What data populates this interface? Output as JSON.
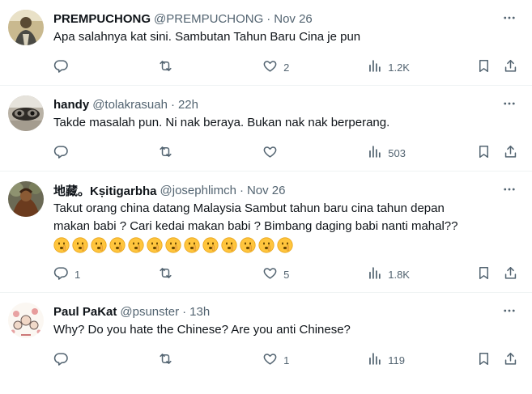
{
  "tweets": [
    {
      "name": "PREMPUCHONG",
      "handle": "@PREMPUCHONG",
      "dot": "·",
      "time": "Nov 26",
      "lines": [
        "Apa salahnya kat sini. Sambutan Tahun Baru Cina je pun"
      ],
      "emoji_count": 0,
      "replies": "",
      "retweets": "",
      "likes": "2",
      "views": "1.2K"
    },
    {
      "name": "handy",
      "handle": "@tolakrasuah",
      "dot": "·",
      "time": "22h",
      "lines": [
        "Takde masalah pun. Ni nak beraya. Bukan nak nak berperang."
      ],
      "emoji_count": 0,
      "replies": "",
      "retweets": "",
      "likes": "",
      "views": "503"
    },
    {
      "name": "地藏。Kṣitigarbha",
      "handle": "@josephlimch",
      "dot": "·",
      "time": "Nov 26",
      "lines": [
        "Takut orang china datang Malaysia Sambut tahun baru cina tahun depan",
        "makan babi ? Cari kedai makan babi ? Bimbang daging babi nanti mahal??"
      ],
      "emoji_count": 13,
      "emoji_name": "shushing-face-emoji",
      "replies": "1",
      "retweets": "",
      "likes": "5",
      "views": "1.8K"
    },
    {
      "name": "Paul PaKat",
      "handle": "@psunster",
      "dot": "·",
      "time": "13h",
      "lines": [
        "Why? Do you hate the Chinese? Are you anti Chinese?"
      ],
      "emoji_count": 0,
      "replies": "",
      "retweets": "",
      "likes": "1",
      "views": "119"
    }
  ],
  "icons": {
    "reply": "reply-icon",
    "retweet": "retweet-icon",
    "like": "heart-icon",
    "views": "views-chart-icon",
    "bookmark": "bookmark-icon",
    "share": "share-icon",
    "more": "more-dots-icon"
  },
  "colors": {
    "text": "#0f1419",
    "muted": "#536471",
    "divider": "#eff3f4"
  }
}
